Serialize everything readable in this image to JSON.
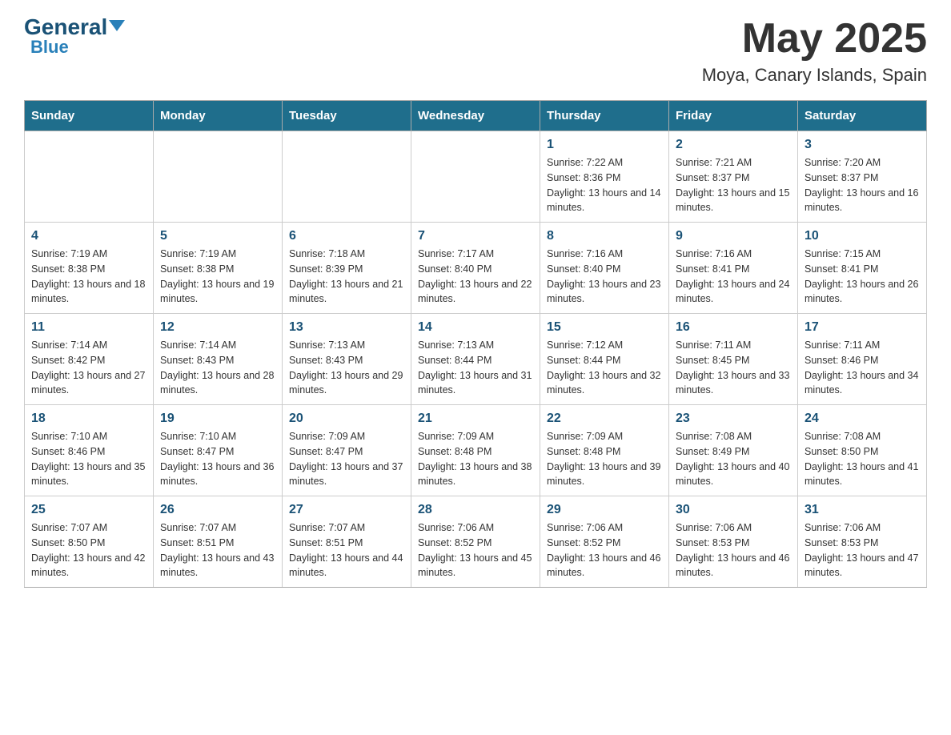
{
  "logo": {
    "general": "General",
    "blue": "Blue"
  },
  "title": "May 2025",
  "subtitle": "Moya, Canary Islands, Spain",
  "days_of_week": [
    "Sunday",
    "Monday",
    "Tuesday",
    "Wednesday",
    "Thursday",
    "Friday",
    "Saturday"
  ],
  "weeks": [
    {
      "days": [
        {
          "number": "",
          "info": ""
        },
        {
          "number": "",
          "info": ""
        },
        {
          "number": "",
          "info": ""
        },
        {
          "number": "",
          "info": ""
        },
        {
          "number": "1",
          "info": "Sunrise: 7:22 AM\nSunset: 8:36 PM\nDaylight: 13 hours and 14 minutes."
        },
        {
          "number": "2",
          "info": "Sunrise: 7:21 AM\nSunset: 8:37 PM\nDaylight: 13 hours and 15 minutes."
        },
        {
          "number": "3",
          "info": "Sunrise: 7:20 AM\nSunset: 8:37 PM\nDaylight: 13 hours and 16 minutes."
        }
      ]
    },
    {
      "days": [
        {
          "number": "4",
          "info": "Sunrise: 7:19 AM\nSunset: 8:38 PM\nDaylight: 13 hours and 18 minutes."
        },
        {
          "number": "5",
          "info": "Sunrise: 7:19 AM\nSunset: 8:38 PM\nDaylight: 13 hours and 19 minutes."
        },
        {
          "number": "6",
          "info": "Sunrise: 7:18 AM\nSunset: 8:39 PM\nDaylight: 13 hours and 21 minutes."
        },
        {
          "number": "7",
          "info": "Sunrise: 7:17 AM\nSunset: 8:40 PM\nDaylight: 13 hours and 22 minutes."
        },
        {
          "number": "8",
          "info": "Sunrise: 7:16 AM\nSunset: 8:40 PM\nDaylight: 13 hours and 23 minutes."
        },
        {
          "number": "9",
          "info": "Sunrise: 7:16 AM\nSunset: 8:41 PM\nDaylight: 13 hours and 24 minutes."
        },
        {
          "number": "10",
          "info": "Sunrise: 7:15 AM\nSunset: 8:41 PM\nDaylight: 13 hours and 26 minutes."
        }
      ]
    },
    {
      "days": [
        {
          "number": "11",
          "info": "Sunrise: 7:14 AM\nSunset: 8:42 PM\nDaylight: 13 hours and 27 minutes."
        },
        {
          "number": "12",
          "info": "Sunrise: 7:14 AM\nSunset: 8:43 PM\nDaylight: 13 hours and 28 minutes."
        },
        {
          "number": "13",
          "info": "Sunrise: 7:13 AM\nSunset: 8:43 PM\nDaylight: 13 hours and 29 minutes."
        },
        {
          "number": "14",
          "info": "Sunrise: 7:13 AM\nSunset: 8:44 PM\nDaylight: 13 hours and 31 minutes."
        },
        {
          "number": "15",
          "info": "Sunrise: 7:12 AM\nSunset: 8:44 PM\nDaylight: 13 hours and 32 minutes."
        },
        {
          "number": "16",
          "info": "Sunrise: 7:11 AM\nSunset: 8:45 PM\nDaylight: 13 hours and 33 minutes."
        },
        {
          "number": "17",
          "info": "Sunrise: 7:11 AM\nSunset: 8:46 PM\nDaylight: 13 hours and 34 minutes."
        }
      ]
    },
    {
      "days": [
        {
          "number": "18",
          "info": "Sunrise: 7:10 AM\nSunset: 8:46 PM\nDaylight: 13 hours and 35 minutes."
        },
        {
          "number": "19",
          "info": "Sunrise: 7:10 AM\nSunset: 8:47 PM\nDaylight: 13 hours and 36 minutes."
        },
        {
          "number": "20",
          "info": "Sunrise: 7:09 AM\nSunset: 8:47 PM\nDaylight: 13 hours and 37 minutes."
        },
        {
          "number": "21",
          "info": "Sunrise: 7:09 AM\nSunset: 8:48 PM\nDaylight: 13 hours and 38 minutes."
        },
        {
          "number": "22",
          "info": "Sunrise: 7:09 AM\nSunset: 8:48 PM\nDaylight: 13 hours and 39 minutes."
        },
        {
          "number": "23",
          "info": "Sunrise: 7:08 AM\nSunset: 8:49 PM\nDaylight: 13 hours and 40 minutes."
        },
        {
          "number": "24",
          "info": "Sunrise: 7:08 AM\nSunset: 8:50 PM\nDaylight: 13 hours and 41 minutes."
        }
      ]
    },
    {
      "days": [
        {
          "number": "25",
          "info": "Sunrise: 7:07 AM\nSunset: 8:50 PM\nDaylight: 13 hours and 42 minutes."
        },
        {
          "number": "26",
          "info": "Sunrise: 7:07 AM\nSunset: 8:51 PM\nDaylight: 13 hours and 43 minutes."
        },
        {
          "number": "27",
          "info": "Sunrise: 7:07 AM\nSunset: 8:51 PM\nDaylight: 13 hours and 44 minutes."
        },
        {
          "number": "28",
          "info": "Sunrise: 7:06 AM\nSunset: 8:52 PM\nDaylight: 13 hours and 45 minutes."
        },
        {
          "number": "29",
          "info": "Sunrise: 7:06 AM\nSunset: 8:52 PM\nDaylight: 13 hours and 46 minutes."
        },
        {
          "number": "30",
          "info": "Sunrise: 7:06 AM\nSunset: 8:53 PM\nDaylight: 13 hours and 46 minutes."
        },
        {
          "number": "31",
          "info": "Sunrise: 7:06 AM\nSunset: 8:53 PM\nDaylight: 13 hours and 47 minutes."
        }
      ]
    }
  ]
}
